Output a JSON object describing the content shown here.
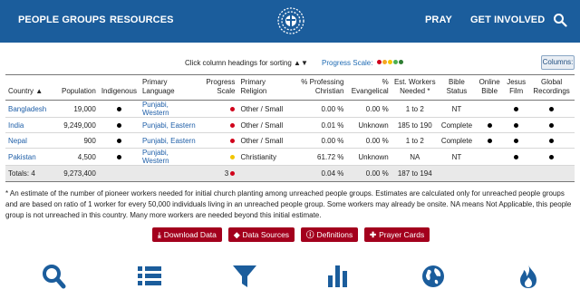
{
  "nav": {
    "people_groups": "PEOPLE GROUPS",
    "resources": "RESOURCES",
    "pray": "PRAY",
    "get_involved": "GET INVOLVED"
  },
  "toolbar": {
    "sort_hint": "Click column headings for sorting ▲▼",
    "progress_scale_label": "Progress Scale:",
    "scale_colors": [
      "#d0021b",
      "#f5a623",
      "#f2c500",
      "#4caf50",
      "#2e7d32"
    ],
    "columns_button": "Columns:"
  },
  "table": {
    "headers": {
      "country": "Country ▲",
      "population": "Population",
      "indigenous": "Indigenous",
      "language_1": "Primary",
      "language_2": "Language",
      "progress_1": "Progress",
      "progress_2": "Scale",
      "religion_1": "Primary",
      "religion_2": "Religion",
      "christian_1": "% Professing",
      "christian_2": "Christian",
      "evangelical_1": "%",
      "evangelical_2": "Evangelical",
      "workers_1": "Est. Workers",
      "workers_2": "Needed *",
      "bible_1": "Bible",
      "bible_2": "Status",
      "online_1": "Online",
      "online_2": "Bible",
      "jesus_1": "Jesus",
      "jesus_2": "Film",
      "recordings_1": "Global",
      "recordings_2": "Recordings"
    },
    "rows": [
      {
        "country": "Bangladesh",
        "population": "19,000",
        "indigenous": true,
        "language": "Punjabi, Western",
        "progress": "red",
        "religion": "Other / Small",
        "christian": "0.00 %",
        "evangelical": "0.00 %",
        "workers": "1 to 2",
        "bible": "NT",
        "online_bible": false,
        "jesus_film": true,
        "recordings": true
      },
      {
        "country": "India",
        "population": "9,249,000",
        "indigenous": true,
        "language": "Punjabi, Eastern",
        "progress": "red",
        "religion": "Other / Small",
        "christian": "0.01 %",
        "evangelical": "Unknown",
        "workers": "185 to 190",
        "bible": "Complete",
        "online_bible": true,
        "jesus_film": true,
        "recordings": true
      },
      {
        "country": "Nepal",
        "population": "900",
        "indigenous": true,
        "language": "Punjabi, Eastern",
        "progress": "red",
        "religion": "Other / Small",
        "christian": "0.00 %",
        "evangelical": "0.00 %",
        "workers": "1 to 2",
        "bible": "Complete",
        "online_bible": true,
        "jesus_film": true,
        "recordings": true
      },
      {
        "country": "Pakistan",
        "population": "4,500",
        "indigenous": true,
        "language": "Punjabi, Western",
        "progress": "yellow",
        "religion": "Christianity",
        "christian": "61.72 %",
        "evangelical": "Unknown",
        "workers": "NA",
        "bible": "NT",
        "online_bible": false,
        "jesus_film": true,
        "recordings": true
      }
    ],
    "totals": {
      "label": "Totals:  4",
      "population": "9,273,400",
      "progress": "3",
      "christian": "0.04 %",
      "evangelical": "0.00 %",
      "workers": "187 to 194"
    }
  },
  "footnote": "* An estimate of the number of pioneer workers needed for initial church planting among unreached people groups. Estimates are calculated only for unreached people groups and are based on ratio of 1 worker for every 50,000 individuals living in an unreached people group. Some workers may already be onsite. NA means Not Applicable, this people group is not unreached in this country. Many more workers are needed beyond this initial estimate.",
  "buttons": {
    "download": "Download Data",
    "sources": "Data Sources",
    "definitions": "Definitions",
    "prayer": "Prayer Cards"
  },
  "colors": {
    "header_bg": "#1b5d9c",
    "accent_red": "#a3001d",
    "link_blue": "#1f5fa8",
    "icon_blue": "#1b5d9c"
  }
}
